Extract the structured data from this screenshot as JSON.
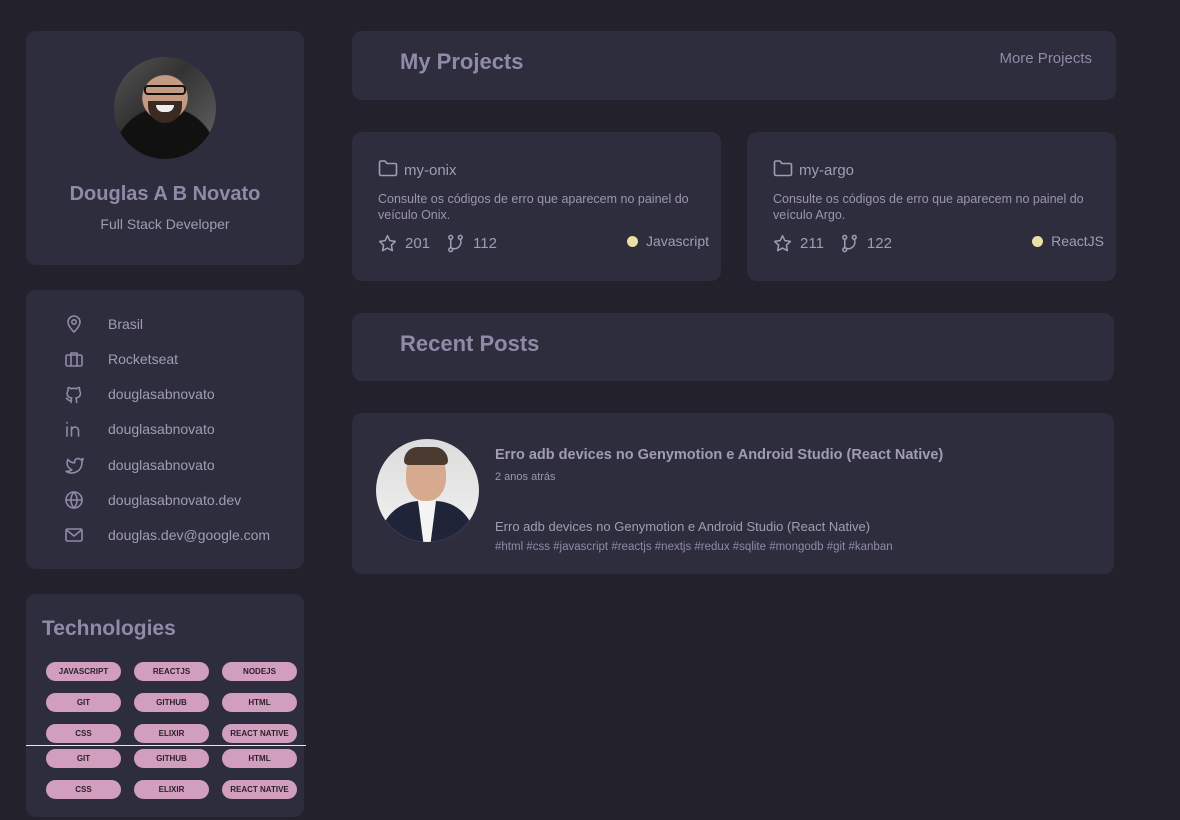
{
  "profile": {
    "name": "Douglas A B Novato",
    "role": "Full Stack Developer"
  },
  "info": {
    "items": [
      {
        "icon": "map-pin-icon",
        "label": "Brasil"
      },
      {
        "icon": "briefcase-icon",
        "label": "Rocketseat"
      },
      {
        "icon": "github-icon",
        "label": "douglasabnovato"
      },
      {
        "icon": "linkedin-icon",
        "label": "douglasabnovato"
      },
      {
        "icon": "twitter-icon",
        "label": "douglasabnovato"
      },
      {
        "icon": "globe-icon",
        "label": "douglasabnovato.dev"
      },
      {
        "icon": "mail-icon",
        "label": "douglas.dev@google.com"
      }
    ]
  },
  "technologies": {
    "title": "Technologies",
    "tags": [
      "JAVASCRIPT",
      "REACTJS",
      "NODEJS",
      "GIT",
      "GITHUB",
      "HTML",
      "CSS",
      "ELIXIR",
      "REACT NATIVE",
      "GIT",
      "GITHUB",
      "HTML",
      "CSS",
      "ELIXIR",
      "REACT NATIVE"
    ]
  },
  "projects_header": {
    "title": "My Projects",
    "more_label": "More Projects"
  },
  "projects": [
    {
      "name": "my-onix",
      "description": "Consulte os códigos de erro que aparecem no painel do veículo Onix.",
      "stars": "201",
      "forks": "112",
      "language": "Javascript"
    },
    {
      "name": "my-argo",
      "description": "Consulte os códigos de erro que aparecem no painel do veículo Argo.",
      "stars": "211",
      "forks": "122",
      "language": "ReactJS"
    }
  ],
  "posts_header": {
    "title": "Recent Posts"
  },
  "post": {
    "title": "Erro adb devices no Genymotion e Android Studio (React Native)",
    "time": "2 anos atrás",
    "description": "Erro adb devices no Genymotion e Android Studio (React Native)",
    "tags": "#html #css #javascript #reactjs #nextjs #redux #sqlite #mongodb #git #kanban"
  },
  "colors": {
    "background": "#22212c",
    "card": "#2e2d3d",
    "tag": "#d19ebd",
    "language_dot": "#e8e0a4"
  }
}
